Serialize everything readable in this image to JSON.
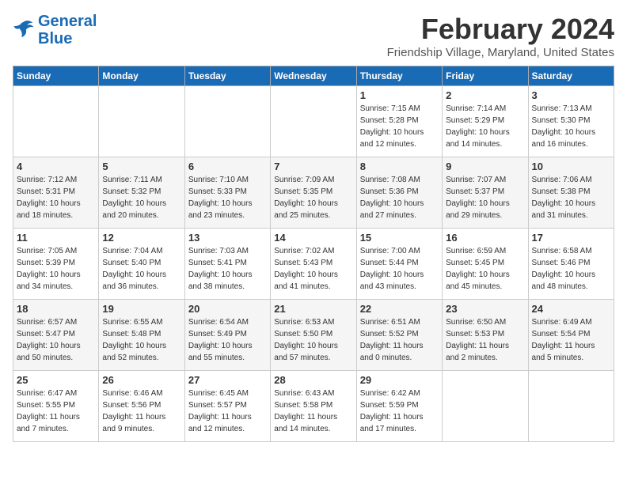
{
  "header": {
    "logo_line1": "General",
    "logo_line2": "Blue",
    "title": "February 2024",
    "subtitle": "Friendship Village, Maryland, United States"
  },
  "days_of_week": [
    "Sunday",
    "Monday",
    "Tuesday",
    "Wednesday",
    "Thursday",
    "Friday",
    "Saturday"
  ],
  "weeks": [
    [
      {
        "day": "",
        "info": ""
      },
      {
        "day": "",
        "info": ""
      },
      {
        "day": "",
        "info": ""
      },
      {
        "day": "",
        "info": ""
      },
      {
        "day": "1",
        "info": "Sunrise: 7:15 AM\nSunset: 5:28 PM\nDaylight: 10 hours\nand 12 minutes."
      },
      {
        "day": "2",
        "info": "Sunrise: 7:14 AM\nSunset: 5:29 PM\nDaylight: 10 hours\nand 14 minutes."
      },
      {
        "day": "3",
        "info": "Sunrise: 7:13 AM\nSunset: 5:30 PM\nDaylight: 10 hours\nand 16 minutes."
      }
    ],
    [
      {
        "day": "4",
        "info": "Sunrise: 7:12 AM\nSunset: 5:31 PM\nDaylight: 10 hours\nand 18 minutes."
      },
      {
        "day": "5",
        "info": "Sunrise: 7:11 AM\nSunset: 5:32 PM\nDaylight: 10 hours\nand 20 minutes."
      },
      {
        "day": "6",
        "info": "Sunrise: 7:10 AM\nSunset: 5:33 PM\nDaylight: 10 hours\nand 23 minutes."
      },
      {
        "day": "7",
        "info": "Sunrise: 7:09 AM\nSunset: 5:35 PM\nDaylight: 10 hours\nand 25 minutes."
      },
      {
        "day": "8",
        "info": "Sunrise: 7:08 AM\nSunset: 5:36 PM\nDaylight: 10 hours\nand 27 minutes."
      },
      {
        "day": "9",
        "info": "Sunrise: 7:07 AM\nSunset: 5:37 PM\nDaylight: 10 hours\nand 29 minutes."
      },
      {
        "day": "10",
        "info": "Sunrise: 7:06 AM\nSunset: 5:38 PM\nDaylight: 10 hours\nand 31 minutes."
      }
    ],
    [
      {
        "day": "11",
        "info": "Sunrise: 7:05 AM\nSunset: 5:39 PM\nDaylight: 10 hours\nand 34 minutes."
      },
      {
        "day": "12",
        "info": "Sunrise: 7:04 AM\nSunset: 5:40 PM\nDaylight: 10 hours\nand 36 minutes."
      },
      {
        "day": "13",
        "info": "Sunrise: 7:03 AM\nSunset: 5:41 PM\nDaylight: 10 hours\nand 38 minutes."
      },
      {
        "day": "14",
        "info": "Sunrise: 7:02 AM\nSunset: 5:43 PM\nDaylight: 10 hours\nand 41 minutes."
      },
      {
        "day": "15",
        "info": "Sunrise: 7:00 AM\nSunset: 5:44 PM\nDaylight: 10 hours\nand 43 minutes."
      },
      {
        "day": "16",
        "info": "Sunrise: 6:59 AM\nSunset: 5:45 PM\nDaylight: 10 hours\nand 45 minutes."
      },
      {
        "day": "17",
        "info": "Sunrise: 6:58 AM\nSunset: 5:46 PM\nDaylight: 10 hours\nand 48 minutes."
      }
    ],
    [
      {
        "day": "18",
        "info": "Sunrise: 6:57 AM\nSunset: 5:47 PM\nDaylight: 10 hours\nand 50 minutes."
      },
      {
        "day": "19",
        "info": "Sunrise: 6:55 AM\nSunset: 5:48 PM\nDaylight: 10 hours\nand 52 minutes."
      },
      {
        "day": "20",
        "info": "Sunrise: 6:54 AM\nSunset: 5:49 PM\nDaylight: 10 hours\nand 55 minutes."
      },
      {
        "day": "21",
        "info": "Sunrise: 6:53 AM\nSunset: 5:50 PM\nDaylight: 10 hours\nand 57 minutes."
      },
      {
        "day": "22",
        "info": "Sunrise: 6:51 AM\nSunset: 5:52 PM\nDaylight: 11 hours\nand 0 minutes."
      },
      {
        "day": "23",
        "info": "Sunrise: 6:50 AM\nSunset: 5:53 PM\nDaylight: 11 hours\nand 2 minutes."
      },
      {
        "day": "24",
        "info": "Sunrise: 6:49 AM\nSunset: 5:54 PM\nDaylight: 11 hours\nand 5 minutes."
      }
    ],
    [
      {
        "day": "25",
        "info": "Sunrise: 6:47 AM\nSunset: 5:55 PM\nDaylight: 11 hours\nand 7 minutes."
      },
      {
        "day": "26",
        "info": "Sunrise: 6:46 AM\nSunset: 5:56 PM\nDaylight: 11 hours\nand 9 minutes."
      },
      {
        "day": "27",
        "info": "Sunrise: 6:45 AM\nSunset: 5:57 PM\nDaylight: 11 hours\nand 12 minutes."
      },
      {
        "day": "28",
        "info": "Sunrise: 6:43 AM\nSunset: 5:58 PM\nDaylight: 11 hours\nand 14 minutes."
      },
      {
        "day": "29",
        "info": "Sunrise: 6:42 AM\nSunset: 5:59 PM\nDaylight: 11 hours\nand 17 minutes."
      },
      {
        "day": "",
        "info": ""
      },
      {
        "day": "",
        "info": ""
      }
    ]
  ]
}
